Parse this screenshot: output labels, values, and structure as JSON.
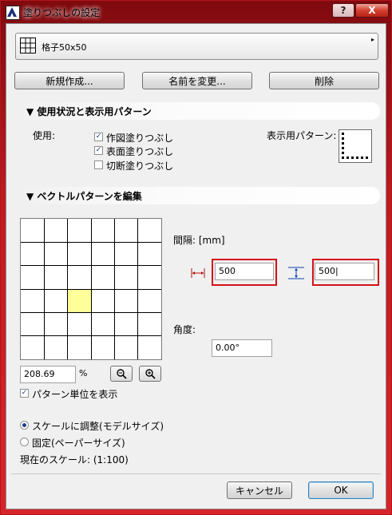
{
  "window": {
    "title": "塗りつぶしの設定",
    "help_label": "?",
    "close_label": "X"
  },
  "fill_selector": {
    "name": "格子50x50",
    "arrow": "▸"
  },
  "buttons": {
    "new": "新規作成...",
    "rename": "名前を変更...",
    "delete": "削除",
    "cancel": "キャンセル",
    "ok": "OK"
  },
  "usage_section": {
    "header": "▼ 使用状況と表示用パターン",
    "use_label": "使用:",
    "options": [
      {
        "label": "作図塗りつぶし",
        "checked": true
      },
      {
        "label": "表面塗りつぶし",
        "checked": true
      },
      {
        "label": "切断塗りつぶし",
        "checked": false
      }
    ],
    "display_pattern_label": "表示用パターン:"
  },
  "vector_section": {
    "header": "▼ ベクトルパターンを編集",
    "spacing_label": "間隔: [mm]",
    "x_spacing": "500",
    "y_spacing": "500|",
    "angle_label": "角度:",
    "angle_value": "0.00°",
    "scale_value": "208.69",
    "scale_unit": "%",
    "show_pattern_unit": "パターン単位を表示",
    "show_pattern_unit_checked": true,
    "highlight_color": "#ffff99"
  },
  "scale_options": {
    "model": "スケールに調整(モデルサイズ)",
    "paper": "固定(ペーパーサイズ)",
    "selected": "model",
    "current_scale": "現在のスケール: (1:100)"
  },
  "icons": {
    "window": "app-icon",
    "pattern": "grid-icon",
    "horizontal": "horizontal-spacing-icon",
    "vertical": "vertical-spacing-icon",
    "zoom_out": "zoom-out-icon",
    "zoom_in": "zoom-in-icon"
  }
}
